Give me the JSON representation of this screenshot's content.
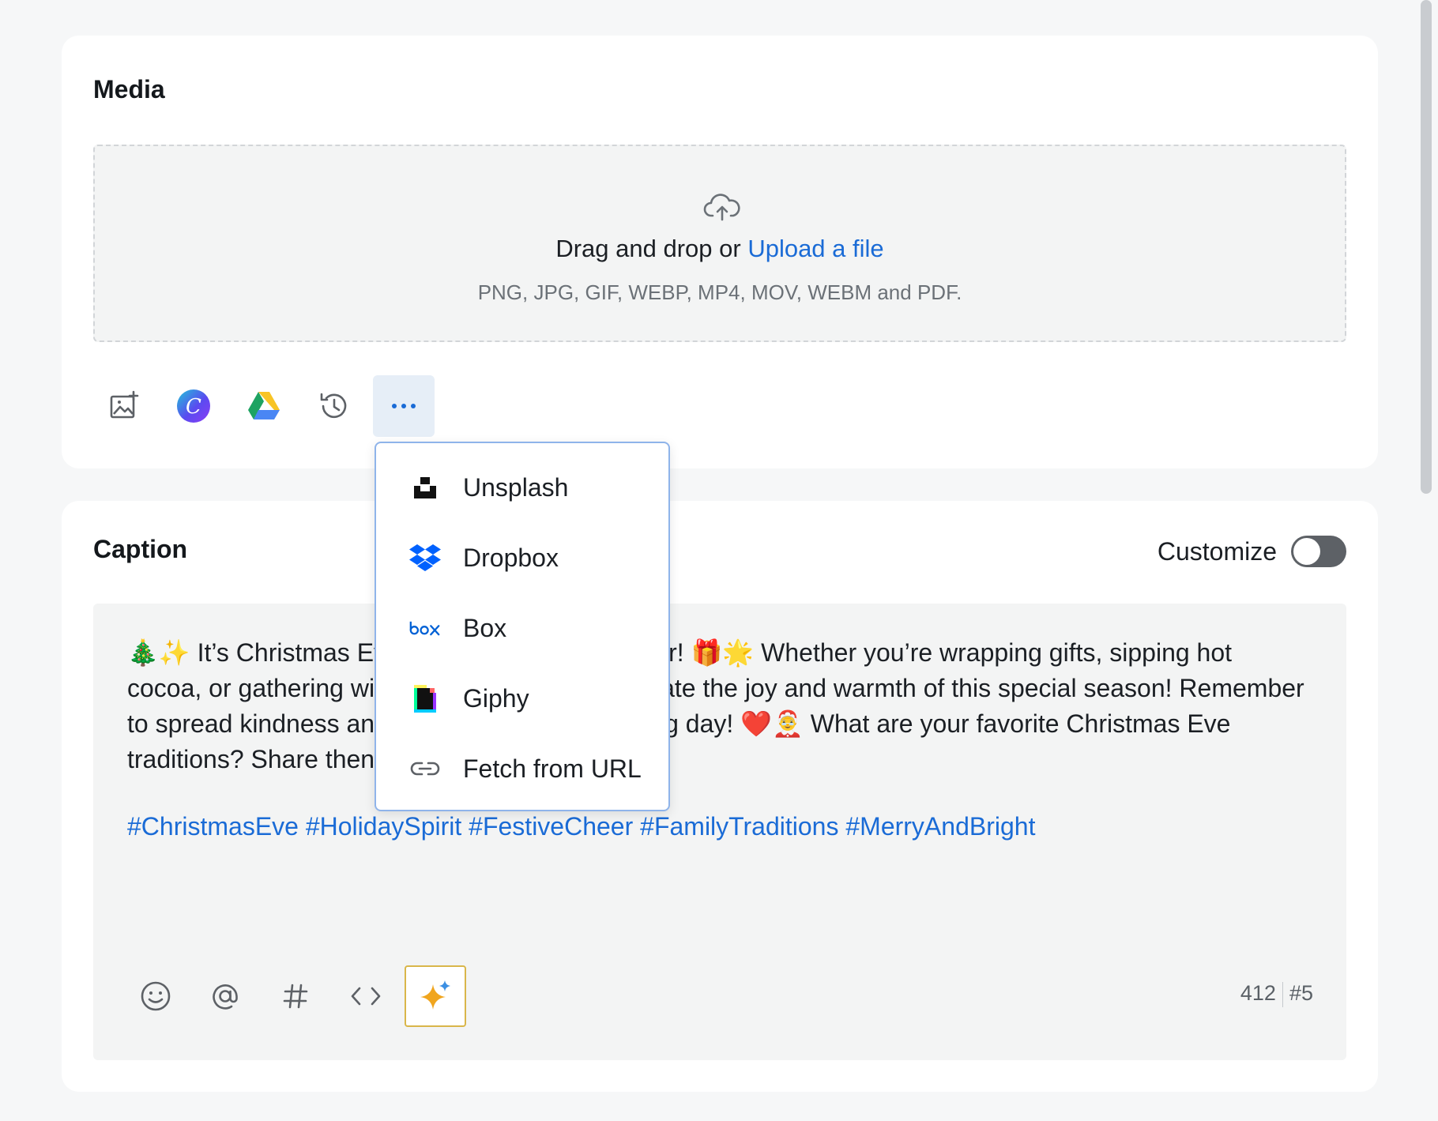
{
  "media": {
    "title": "Media",
    "drop_text": "Drag and drop or ",
    "upload_link": "Upload a file",
    "formats": "PNG, JPG, GIF, WEBP, MP4, MOV, WEBM and PDF.",
    "tools": [
      "image-upload-icon",
      "canva-icon",
      "google-drive-icon",
      "history-icon",
      "more-icon"
    ]
  },
  "dropdown": {
    "items": [
      {
        "label": "Unsplash",
        "icon": "unsplash-icon"
      },
      {
        "label": "Dropbox",
        "icon": "dropbox-icon"
      },
      {
        "label": "Box",
        "icon": "box-icon"
      },
      {
        "label": "Giphy",
        "icon": "giphy-icon"
      },
      {
        "label": "Fetch from URL",
        "icon": "link-icon"
      }
    ]
  },
  "caption": {
    "title": "Caption",
    "customize_label": "Customize",
    "customize_on": false,
    "line1_a": "🎄✨ It’s Christmas Ev",
    "line1_b": "ir! 🎁🌟 Whether you’re wrapping gifts, sipping hot",
    "line2_a": "cocoa, or gathering wi",
    "line2_b": "ate the joy and warmth of this special season! Remember",
    "line3_a": "to spread kindness an",
    "line3_b": "g day! ❤️🤶 What are your favorite Christmas Eve",
    "line4_a": "traditions? Share then",
    "hashtags": "#ChristmasEve #HolidaySpirit #FestiveCheer #FamilyTraditions #MerryAndBright",
    "char_count": "412",
    "hashtag_count": "#5"
  },
  "colors": {
    "accent": "#1a6bd6",
    "ai_border": "#d9b64a"
  }
}
